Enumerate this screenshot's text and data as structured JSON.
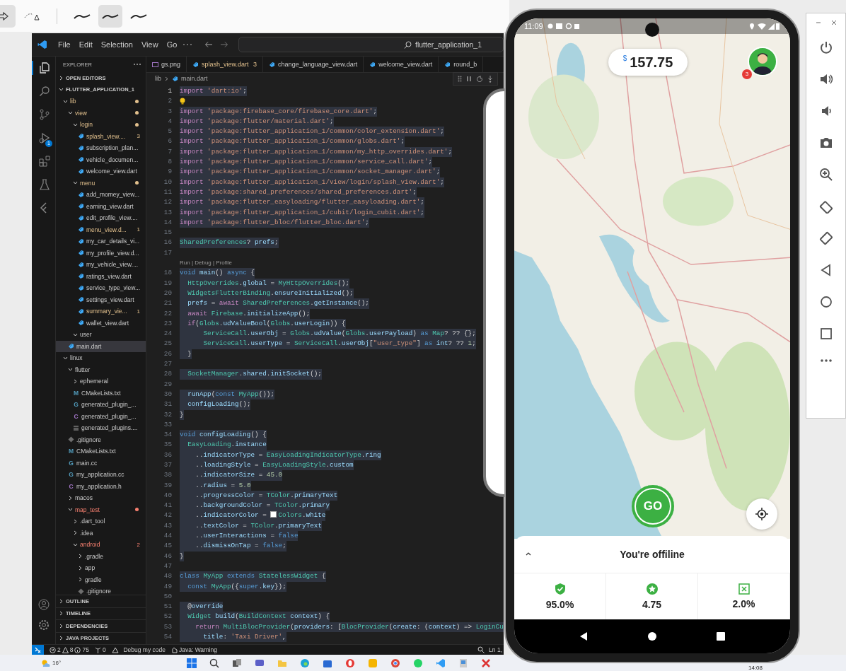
{
  "drawing_toolbar": {
    "tools": [
      {
        "kind": "arrow",
        "selected": true
      },
      {
        "kind": "lasso",
        "selected": false
      },
      {
        "kind": "pen",
        "selected": false
      },
      {
        "kind": "pen",
        "selected": true
      },
      {
        "kind": "pen",
        "selected": false
      }
    ]
  },
  "editor_window": {
    "menu": [
      "File",
      "Edit",
      "Selection",
      "View",
      "Go"
    ],
    "search": {
      "value": "flutter_application_1"
    },
    "activity_bar": [
      {
        "kind": "explorer",
        "selected": true
      },
      {
        "kind": "search",
        "selected": false
      },
      {
        "kind": "source-control",
        "selected": false
      },
      {
        "kind": "run-debug",
        "selected": false,
        "badge": "1"
      },
      {
        "kind": "extensions",
        "selected": false
      },
      {
        "kind": "testing",
        "selected": false
      },
      {
        "kind": "flutter",
        "selected": false
      }
    ],
    "sidebar": {
      "title": "EXPLORER",
      "sections": [
        {
          "label": "OPEN EDITORS",
          "expanded": false
        },
        {
          "label": "FLUTTER_APPLICATION_1",
          "expanded": true,
          "children": [
            {
              "kind": "folder",
              "label": "lib",
              "expanded": true,
              "selected": false,
              "warning": true,
              "children": [
                {
                  "kind": "folder",
                  "label": "view",
                  "expanded": true,
                  "selected": false,
                  "warning": true,
                  "children": [
                    {
                      "kind": "folder",
                      "label": "login",
                      "expanded": true,
                      "selected": false,
                      "warning": true,
                      "children": [
                        {
                          "kind": "dart",
                          "label": "splash_view....",
                          "selected": false,
                          "warning": true,
                          "badge": "3"
                        },
                        {
                          "kind": "dart",
                          "label": "subscription_plan...",
                          "selected": false
                        },
                        {
                          "kind": "dart",
                          "label": "vehicle_documen...",
                          "selected": false
                        },
                        {
                          "kind": "dart",
                          "label": "welcome_view.dart",
                          "selected": false
                        }
                      ]
                    },
                    {
                      "kind": "folder",
                      "label": "menu",
                      "expanded": true,
                      "selected": false,
                      "warning": true,
                      "children": [
                        {
                          "kind": "dart",
                          "label": "add_momey_view...",
                          "selected": false
                        },
                        {
                          "kind": "dart",
                          "label": "earning_view.dart",
                          "selected": false
                        },
                        {
                          "kind": "dart",
                          "label": "edit_profile_view....",
                          "selected": false
                        },
                        {
                          "kind": "dart",
                          "label": "menu_view.d...",
                          "selected": false,
                          "warning": true,
                          "badge": "1"
                        },
                        {
                          "kind": "dart",
                          "label": "my_car_details_vi...",
                          "selected": false
                        },
                        {
                          "kind": "dart",
                          "label": "my_profile_view.d...",
                          "selected": false
                        },
                        {
                          "kind": "dart",
                          "label": "my_vehicle_view....",
                          "selected": false
                        },
                        {
                          "kind": "dart",
                          "label": "ratings_view.dart",
                          "selected": false
                        },
                        {
                          "kind": "dart",
                          "label": "service_type_view...",
                          "selected": false
                        },
                        {
                          "kind": "dart",
                          "label": "settings_view.dart",
                          "selected": false
                        },
                        {
                          "kind": "dart",
                          "label": "summary_vie...",
                          "selected": false,
                          "warning": true,
                          "badge": "1"
                        },
                        {
                          "kind": "dart",
                          "label": "wallet_view.dart",
                          "selected": false
                        }
                      ]
                    },
                    {
                      "kind": "folder",
                      "label": "user",
                      "expanded": true,
                      "selected": false
                    }
                  ]
                },
                {
                  "kind": "dart",
                  "label": "main.dart",
                  "selected": true
                }
              ]
            },
            {
              "kind": "folder",
              "label": "linux",
              "expanded": true,
              "selected": false,
              "children": [
                {
                  "kind": "folder",
                  "label": "flutter",
                  "expanded": true,
                  "selected": false,
                  "children": [
                    {
                      "kind": "folder",
                      "label": "ephemeral",
                      "expanded": false,
                      "selected": false
                    },
                    {
                      "kind": "glyph",
                      "glyph": "M",
                      "color": "#519aba",
                      "label": "CMakeLists.txt",
                      "selected": false
                    },
                    {
                      "kind": "glyph",
                      "glyph": "G",
                      "color": "#519aba",
                      "label": "generated_plugin_...",
                      "selected": false
                    },
                    {
                      "kind": "glyph",
                      "glyph": "C",
                      "color": "#a074c4",
                      "label": "generated_plugin_...",
                      "selected": false
                    },
                    {
                      "kind": "lines",
                      "label": "generated_plugins....",
                      "selected": false
                    }
                  ]
                },
                {
                  "kind": "git",
                  "label": ".gitignore",
                  "selected": false
                },
                {
                  "kind": "glyph",
                  "glyph": "M",
                  "color": "#519aba",
                  "label": "CMakeLists.txt",
                  "selected": false
                },
                {
                  "kind": "glyph",
                  "glyph": "G",
                  "color": "#519aba",
                  "label": "main.cc",
                  "selected": false
                },
                {
                  "kind": "glyph",
                  "glyph": "G",
                  "color": "#519aba",
                  "label": "my_application.cc",
                  "selected": false
                },
                {
                  "kind": "glyph",
                  "glyph": "C",
                  "color": "#a074c4",
                  "label": "my_application.h",
                  "selected": false
                },
                {
                  "kind": "folder",
                  "label": "macos",
                  "expanded": false,
                  "selected": false
                },
                {
                  "kind": "folder",
                  "label": "map_test",
                  "expanded": true,
                  "selected": false,
                  "error": true,
                  "children": [
                    {
                      "kind": "folder",
                      "label": ".dart_tool",
                      "expanded": false,
                      "selected": false
                    },
                    {
                      "kind": "folder",
                      "label": ".idea",
                      "expanded": false,
                      "selected": false
                    },
                    {
                      "kind": "folder",
                      "label": "android",
                      "expanded": true,
                      "selected": false,
                      "error": true,
                      "badge": "2",
                      "children": [
                        {
                          "kind": "folder",
                          "label": ".gradle",
                          "expanded": false,
                          "selected": false
                        },
                        {
                          "kind": "folder",
                          "label": "app",
                          "expanded": false,
                          "selected": false
                        },
                        {
                          "kind": "folder",
                          "label": "gradle",
                          "expanded": false,
                          "selected": false
                        },
                        {
                          "kind": "git",
                          "label": ".gitignore",
                          "selected": false
                        }
                      ]
                    }
                  ]
                }
              ]
            }
          ]
        }
      ],
      "panels": [
        {
          "label": "OUTLINE",
          "expanded": false
        },
        {
          "label": "TIMELINE",
          "expanded": false
        },
        {
          "label": "DEPENDENCIES",
          "expanded": false
        },
        {
          "label": "JAVA PROJECTS",
          "expanded": false
        }
      ]
    },
    "tabs": [
      {
        "kind": "image",
        "label": "gs.png",
        "selected": false
      },
      {
        "kind": "dart",
        "label": "splash_view.dart",
        "badge": "3",
        "warning": true,
        "selected": false
      },
      {
        "kind": "dart",
        "label": "change_language_view.dart",
        "selected": false
      },
      {
        "kind": "dart",
        "label": "welcome_view.dart",
        "selected": false
      },
      {
        "kind": "dart",
        "label": "round_b",
        "selected": false
      }
    ],
    "breadcrumb": [
      "lib",
      "main.dart"
    ],
    "code": [
      {
        "number": "1",
        "text": "import 'dart:io';"
      },
      {
        "number": "2",
        "lightbulb": true
      },
      {
        "number": "3",
        "text": "import 'package:firebase_core/firebase_core.dart';"
      },
      {
        "number": "4",
        "text": "import 'package:flutter/material.dart';"
      },
      {
        "number": "5",
        "text": "import 'package:flutter_application_1/common/color_extension.dart';"
      },
      {
        "number": "6",
        "text": "import 'package:flutter_application_1/common/globs.dart';"
      },
      {
        "number": "7",
        "text": "import 'package:flutter_application_1/common/my_http_overrides.dart';"
      },
      {
        "number": "8",
        "text": "import 'package:flutter_application_1/common/service_call.dart';"
      },
      {
        "number": "9",
        "text": "import 'package:flutter_application_1/common/socket_manager.dart';"
      },
      {
        "number": "10",
        "text": "import 'package:flutter_application_1/view/login/splash_view.dart';"
      },
      {
        "number": "11",
        "text": "import 'package:shared_preferences/shared_preferences.dart';"
      },
      {
        "number": "12",
        "text": "import 'package:flutter_easyloading/flutter_easyloading.dart';"
      },
      {
        "number": "13",
        "text": "import 'package:flutter_application_1/cubit/login_cubit.dart';"
      },
      {
        "number": "14",
        "text": "import 'package:flutter_bloc/flutter_bloc.dart';"
      },
      {
        "number": "15"
      },
      {
        "number": "16",
        "text": "SharedPreferences? prefs;"
      },
      {
        "number": "17"
      },
      {
        "kind": "codelens",
        "text": "Run | Debug | Profile"
      },
      {
        "number": "18",
        "text": "void main() async {"
      },
      {
        "number": "19",
        "text": "  HttpOverrides.global = MyHttpOverrides();"
      },
      {
        "number": "20",
        "text": "  WidgetsFlutterBinding.ensureInitialized();"
      },
      {
        "number": "21",
        "text": "  prefs = await SharedPreferences.getInstance();"
      },
      {
        "number": "22",
        "text": "  await Firebase.initializeApp();"
      },
      {
        "number": "23",
        "text": "  if(Globs.udValueBool(Globs.userLogin)) {"
      },
      {
        "number": "24",
        "text": "      ServiceCall.userObj = Globs.udValue(Globs.userPayload) as Map? ?? {};"
      },
      {
        "number": "25",
        "text": "      ServiceCall.userType = ServiceCall.userObj[\"user_type\"] as int? ?? 1;"
      },
      {
        "number": "26",
        "text": "  }"
      },
      {
        "number": "27"
      },
      {
        "number": "28",
        "text": "  SocketManager.shared.initSocket();"
      },
      {
        "number": "29"
      },
      {
        "number": "30",
        "text": "  runApp(const MyApp());"
      },
      {
        "number": "31",
        "text": "  configLoading();"
      },
      {
        "number": "32",
        "text": "}"
      },
      {
        "number": "33"
      },
      {
        "number": "34",
        "text": "void configLoading() {"
      },
      {
        "number": "35",
        "text": "  EasyLoading.instance"
      },
      {
        "number": "36",
        "text": "    ..indicatorType = EasyLoadingIndicatorType.ring"
      },
      {
        "number": "37",
        "text": "    ..loadingStyle = EasyLoadingStyle.custom"
      },
      {
        "number": "38",
        "text": "    ..indicatorSize = 45.0"
      },
      {
        "number": "39",
        "text": "    ..radius = 5.0"
      },
      {
        "number": "40",
        "text": "    ..progressColor = TColor.primaryText"
      },
      {
        "number": "41",
        "text": "    ..backgroundColor = TColor.primary"
      },
      {
        "number": "42",
        "text": "    ..indicatorColor = ",
        "color": "#ffffff",
        "text_after": "Colors.white"
      },
      {
        "number": "43",
        "text": "    ..textColor = TColor.primaryText"
      },
      {
        "number": "44",
        "text": "    ..userInteractions = false"
      },
      {
        "number": "45",
        "text": "    ..dismissOnTap = false;"
      },
      {
        "number": "46",
        "text": "}"
      },
      {
        "number": "47"
      },
      {
        "number": "48",
        "text": "class MyApp extends StatelessWidget {"
      },
      {
        "number": "49",
        "text": "  const MyApp({super.key});"
      },
      {
        "number": "50"
      },
      {
        "number": "51",
        "text": "  @override"
      },
      {
        "number": "52",
        "text": "  Widget build(BuildContext context) {"
      },
      {
        "number": "53",
        "text": "    return MultiBlocProvider(providers: [BlocProvider(create: (context) => LoginCu"
      },
      {
        "number": "54",
        "text": "      title: 'Taxi Driver',"
      }
    ],
    "status_bar": {
      "errors": "2",
      "warnings": "8",
      "infos": "75",
      "ports": "0",
      "debug": "Debug my code",
      "java": "Java: Warning",
      "position": "Ln 1,"
    }
  },
  "taskbar": {
    "weather": "16°",
    "time": "14:08"
  },
  "phone": {
    "time": "11:09",
    "balance": {
      "currency": "$",
      "amount": "157.75"
    },
    "notifications": "3",
    "go": "GO",
    "sheet": {
      "title": "You're offiline",
      "stats": [
        {
          "kind": "shield",
          "value": "95.0%"
        },
        {
          "kind": "star",
          "value": "4.75"
        },
        {
          "kind": "cross",
          "value": "2.0%"
        }
      ]
    }
  }
}
